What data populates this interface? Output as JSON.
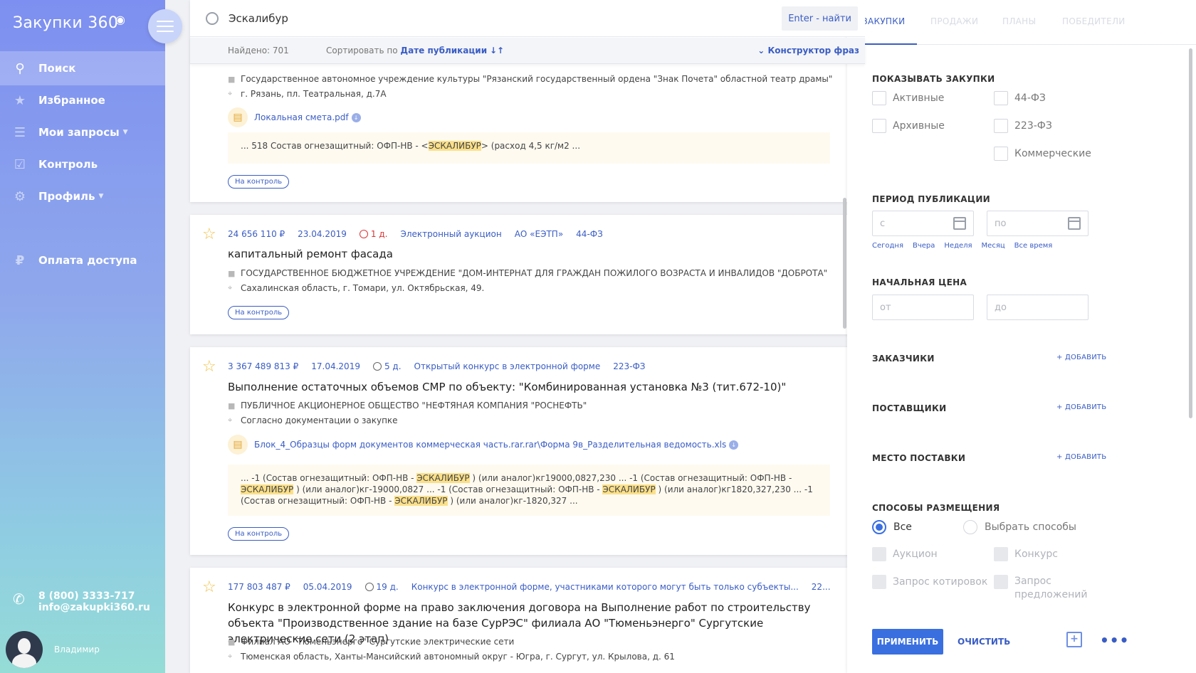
{
  "app": {
    "logo": "Закупки 360",
    "nav": [
      {
        "label": "Поиск",
        "icon": "search-icon"
      },
      {
        "label": "Избранное",
        "icon": "star-icon"
      },
      {
        "label": "Мои запросы",
        "icon": "stack-icon"
      },
      {
        "label": "Контроль",
        "icon": "check-icon"
      },
      {
        "label": "Профиль",
        "icon": "gear-icon"
      },
      {
        "label": "Оплата доступа",
        "icon": "ruble-icon"
      }
    ],
    "phone": "8 (800) 3333-717",
    "email": "info@zakupki360.ru",
    "user_name": "Владимир"
  },
  "search": {
    "query": "Эскалибур",
    "button": "Enter - найти",
    "found": "Найдено: 701",
    "sort_label": "Сортировать по",
    "sort_value": "Дате публикации",
    "sort_arrows": "↓↑",
    "constructor": "Конструктор фраз"
  },
  "control_label": "На контроль",
  "results": [
    {
      "customer": "Государственное автономное учреждение культуры \"Рязанский государственный ордена \"Знак Почета\" областной театр драмы\"",
      "address": "г. Рязань, пл. Театральная, д.7А",
      "doc": "Локальная смета.pdf",
      "snippet": {
        "before": "... 518 Состав огнезащитный: ОФП-НВ - <",
        "hl": "ЭСКАЛИБУР",
        "after": "> (расход 4,5 кг/м2 ..."
      }
    },
    {
      "price": "24 656 110 ₽",
      "date": "23.04.2019",
      "days": "1 д.",
      "method": "Электронный аукцион",
      "platform": "АО «ЕЭТП»",
      "law": "44-ФЗ",
      "title": "капитальный ремонт фасада",
      "customer": "ГОСУДАРСТВЕННОЕ БЮДЖЕТНОЕ УЧРЕЖДЕНИЕ \"ДОМ-ИНТЕРНАТ ДЛЯ ГРАЖДАН ПОЖИЛОГО ВОЗРАСТА И ИНВАЛИДОВ \"ДОБРОТА\"",
      "address": "Сахалинская область, г. Томари, ул. Октябрьская, 49."
    },
    {
      "price": "3 367 489 813 ₽",
      "date": "17.04.2019",
      "days": "5 д.",
      "method": "Открытый конкурс в электронной форме",
      "law": "223-ФЗ",
      "title": "Выполнение остаточных объемов СМР по объекту: \"Комбинированная установка №3 (тит.672-10)\"",
      "customer": "ПУБЛИЧНОЕ АКЦИОНЕРНОЕ ОБЩЕСТВО \"НЕФТЯНАЯ КОМПАНИЯ \"РОСНЕФТЬ\"",
      "address": "Согласно документации о закупке",
      "doc": "Блок_4_Образцы форм документов коммерческая часть.rar.rar\\Форма 9в_Разделительная ведомость.xls",
      "snippet": {
        "p1": "... -1 (Состав огнезащитный: ОФП-НВ - ",
        "hl": "ЭСКАЛИБУР",
        "p2": " ) (или аналог)кг19000,0827,230 ... -1 (Состав огнезащитный: ОФП-НВ - ",
        "p3": " ) (или аналог)кг-19000,0827 ... -1 (Состав огнезащитный: ОФП-НВ - ",
        "p4": " ) (или аналог)кг1820,327,230 ... -1 (Состав огнезащитный: ОФП-НВ - ",
        "p5": " ) (или аналог)кг-1820,327 ..."
      }
    },
    {
      "price": "177 803 487 ₽",
      "date": "05.04.2019",
      "days": "19 д.",
      "method": "Конкурс в электронной форме, участниками которого могут быть только субъекты...",
      "law": "22...",
      "title": "Конкурс в электронной форме на право заключения договора на Выполнение работ по строительству объекта \"Производственное здание на базе СурРЭС\" филиала АО \"Тюменьэнерго\" Сургутские электрические сети (2 этап)",
      "customer": "Филиал АО \"Тюменьэнерго\" Сургутские электрические сети",
      "address": "Тюменская область, Ханты-Мансийский автономный округ - Югра, г. Сургут, ул. Крылова, д. 61"
    }
  ],
  "filters": {
    "tabs": [
      "ЗАКУПКИ",
      "ПРОДАЖИ",
      "ПЛАНЫ",
      "ПОБЕДИТЕЛИ"
    ],
    "show_title": "ПОКАЗЫВАТЬ ЗАКУПКИ",
    "show": {
      "active": "Активные",
      "archive": "Архивные",
      "fz44": "44-ФЗ",
      "fz223": "223-ФЗ",
      "commercial": "Коммерческие"
    },
    "period_title": "ПЕРИОД ПУБЛИКАЦИИ",
    "from_ph": "с",
    "to_ph": "по",
    "quick": [
      "Сегодня",
      "Вчера",
      "Неделя",
      "Месяц",
      "Все время"
    ],
    "price_title": "НАЧАЛЬНАЯ ЦЕНА",
    "price_from": "от",
    "price_to": "до",
    "customers": "ЗАКАЗЧИКИ",
    "suppliers": "ПОСТАВЩИКИ",
    "place": "МЕСТО ПОСТАВКИ",
    "add": "+ ДОБАВИТЬ",
    "methods_title": "СПОСОБЫ РАЗМЕЩЕНИЯ",
    "methods_all": "Все",
    "methods_choose": "Выбрать способы",
    "m_auction": "Аукцион",
    "m_contest": "Конкурс",
    "m_quote": "Запрос котировок",
    "m_offer": "Запрос предложений",
    "apply": "ПРИМЕНИТЬ",
    "clear": "ОЧИСТИТЬ"
  }
}
